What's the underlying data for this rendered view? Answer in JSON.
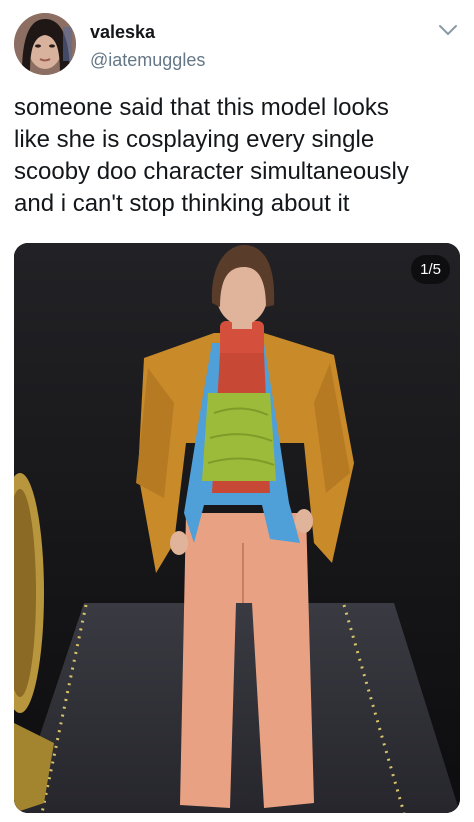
{
  "author": {
    "display_name": "valeska",
    "handle": "@iatemuggles"
  },
  "tweet": {
    "text": "someone said that this model looks\nlike she is cosplaying every single\nscooby doo character simultaneously\nand i can't stop thinking about it"
  },
  "media": {
    "counter": "1/5"
  },
  "icons": {
    "menu": "chevron-down-icon"
  },
  "colors": {
    "text_primary": "#14171a",
    "text_secondary": "#657786",
    "jacket": "#c98a2a",
    "turtleneck": "#d4503c",
    "top": "#9dbb3a",
    "shirt": "#4f9fd8",
    "trousers": "#e8a283"
  }
}
